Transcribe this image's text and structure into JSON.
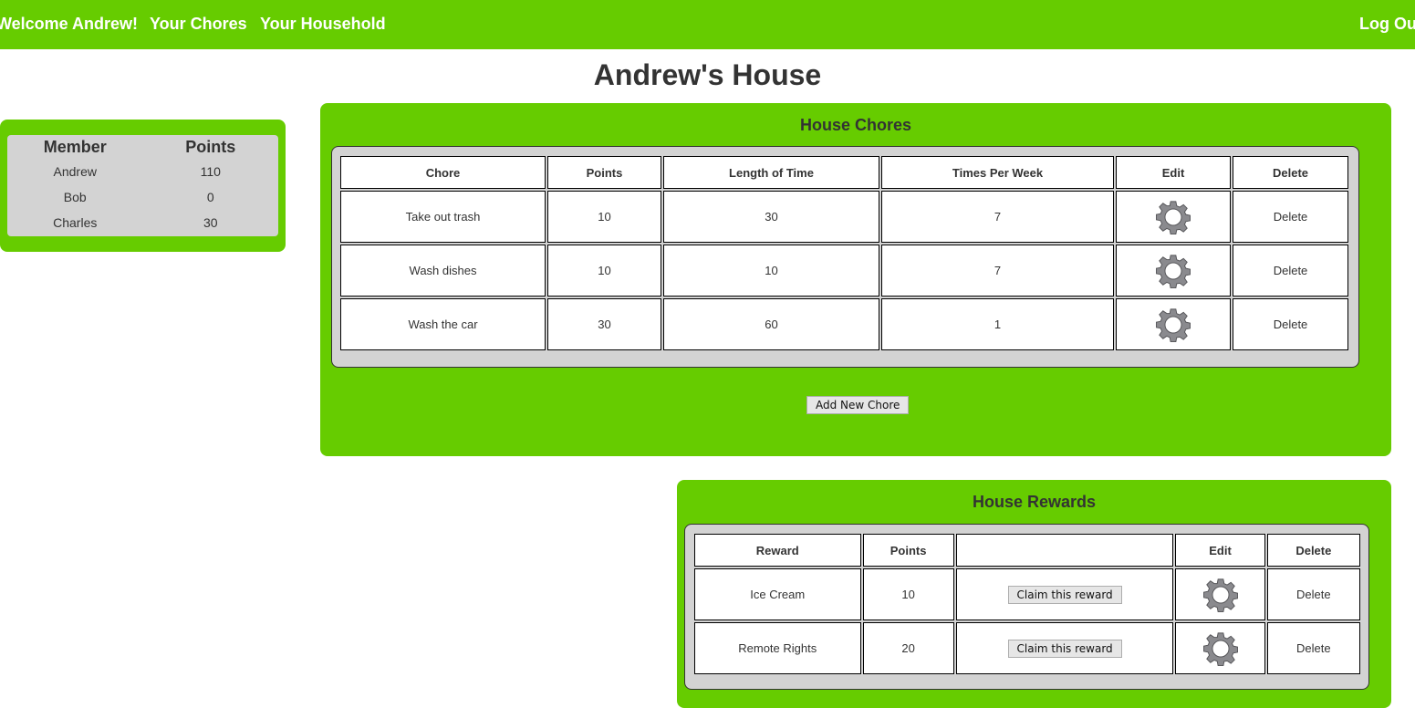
{
  "nav": {
    "welcome": "Welcome Andrew!",
    "your_chores": "Your Chores",
    "your_household": "Your Household",
    "logout": "Log Out"
  },
  "page_title": "Andrew's House",
  "members": {
    "headers": [
      "Member",
      "Points"
    ],
    "rows": [
      {
        "name": "Andrew",
        "points": "110"
      },
      {
        "name": "Bob",
        "points": "0"
      },
      {
        "name": "Charles",
        "points": "30"
      }
    ]
  },
  "chores": {
    "title": "House Chores",
    "headers": [
      "Chore",
      "Points",
      "Length of Time",
      "Times Per Week",
      "Edit",
      "Delete"
    ],
    "rows": [
      {
        "chore": "Take out trash",
        "points": "10",
        "length": "30",
        "times": "7",
        "delete": "Delete"
      },
      {
        "chore": "Wash dishes",
        "points": "10",
        "length": "10",
        "times": "7",
        "delete": "Delete"
      },
      {
        "chore": "Wash the car",
        "points": "30",
        "length": "60",
        "times": "1",
        "delete": "Delete"
      }
    ],
    "add_button": "Add New Chore"
  },
  "rewards": {
    "title": "House Rewards",
    "headers": [
      "Reward",
      "Points",
      "",
      "Edit",
      "Delete"
    ],
    "rows": [
      {
        "reward": "Ice Cream",
        "points": "10",
        "claim": "Claim this reward",
        "delete": "Delete"
      },
      {
        "reward": "Remote Rights",
        "points": "20",
        "claim": "Claim this reward",
        "delete": "Delete"
      }
    ]
  },
  "colors": {
    "accent": "#66cc00",
    "panel_inner": "#d3d3d3",
    "gear": "#8a8a8e"
  },
  "icons": {
    "edit": "gear-icon"
  }
}
